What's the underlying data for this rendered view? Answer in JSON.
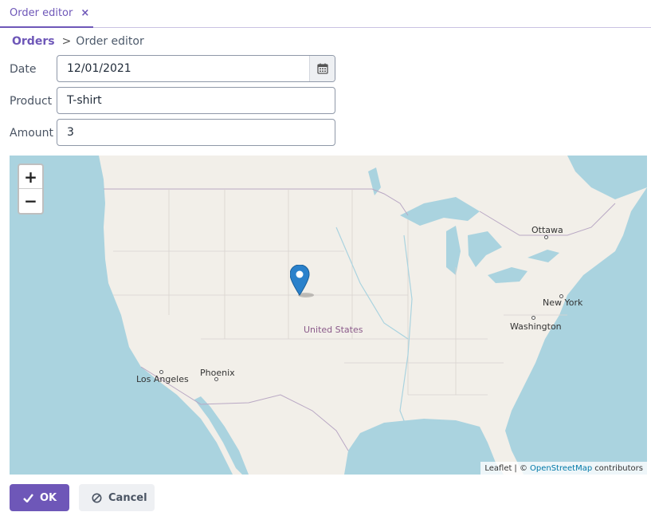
{
  "tabs": [
    {
      "label": "Order editor",
      "close": "×"
    }
  ],
  "breadcrumb": {
    "parent": "Orders",
    "separator": ">",
    "current": "Order editor"
  },
  "form": {
    "date": {
      "label": "Date",
      "value": "12/01/2021",
      "icon": "calendar-icon"
    },
    "product": {
      "label": "Product",
      "value": "T-shirt"
    },
    "amount": {
      "label": "Amount",
      "value": "3"
    }
  },
  "map": {
    "zoom_in": "+",
    "zoom_out": "−",
    "labels": {
      "ottawa": "Ottawa",
      "new_york": "New York",
      "washington": "Washington",
      "united_states": "United States",
      "phoenix": "Phoenix",
      "los_angeles": "Los Angeles"
    },
    "attribution": {
      "leaflet": "Leaflet",
      "sep": "| ©",
      "osm": "OpenStreetMap",
      "contributors": "contributors"
    },
    "colors": {
      "water": "#aad3df",
      "land": "#f2efe9",
      "marker": "#2a81cb"
    }
  },
  "actions": {
    "ok_label": "OK",
    "cancel_label": "Cancel"
  },
  "colors": {
    "accent": "#6e57b8"
  }
}
